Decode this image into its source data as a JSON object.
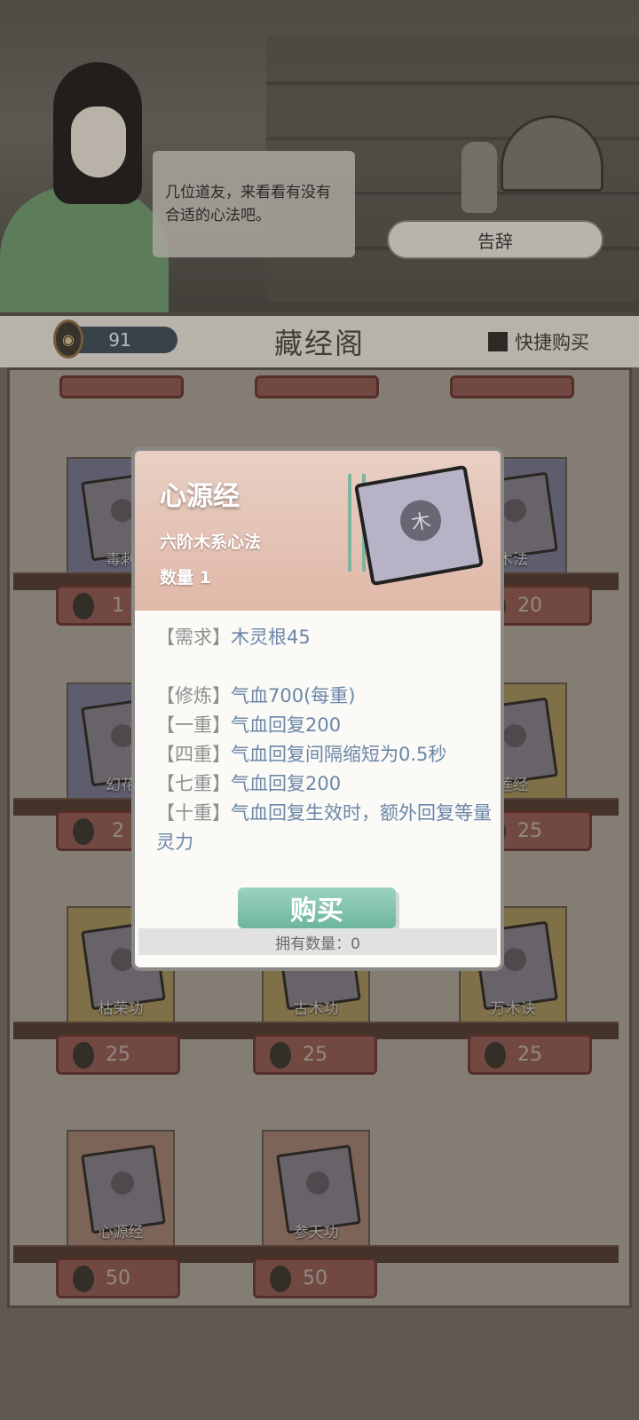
{
  "npc": {
    "dialog": "几位道友，来看看有没有合适的心法吧。",
    "farewell_label": "告辞"
  },
  "header": {
    "currency": "91",
    "title": "藏经阁",
    "quick_buy_label": "快捷购买"
  },
  "shop_items": [
    {
      "name": "毒刺",
      "price": "1",
      "color": "#8a8cb0"
    },
    {
      "name": "木法",
      "price": "20",
      "color": "#8a8cb0"
    },
    {
      "name": "幻花",
      "price": "2",
      "color": "#8a8cb0"
    },
    {
      "name": "莲经",
      "price": "25",
      "color": "#c8b06a"
    },
    {
      "name": "枯荣功",
      "price": "25",
      "color": "#c8b06a"
    },
    {
      "name": "古木功",
      "price": "25",
      "color": "#c8b06a"
    },
    {
      "name": "万木诀",
      "price": "25",
      "color": "#c8b06a"
    },
    {
      "name": "心源经",
      "price": "50",
      "color": "#c49a87"
    },
    {
      "name": "参天功",
      "price": "50",
      "color": "#c49a87"
    }
  ],
  "modal": {
    "title": "心源经",
    "subtitle": "六阶木系心法",
    "quantity": "数量 1",
    "seal_glyph": "木",
    "lines": [
      {
        "key": "【需求】",
        "value": "木灵根45"
      },
      {
        "key": "【修炼】",
        "value": "气血700(每重)"
      },
      {
        "key": "【一重】",
        "value": "气血回复200"
      },
      {
        "key": "【四重】",
        "value": "气血回复间隔缩短为0.5秒"
      },
      {
        "key": "【七重】",
        "value": "气血回复200"
      },
      {
        "key": "【十重】",
        "value": "气血回复生效时，额外回复等量灵力"
      }
    ],
    "buy_label": "购买",
    "owned": "拥有数量：0"
  }
}
